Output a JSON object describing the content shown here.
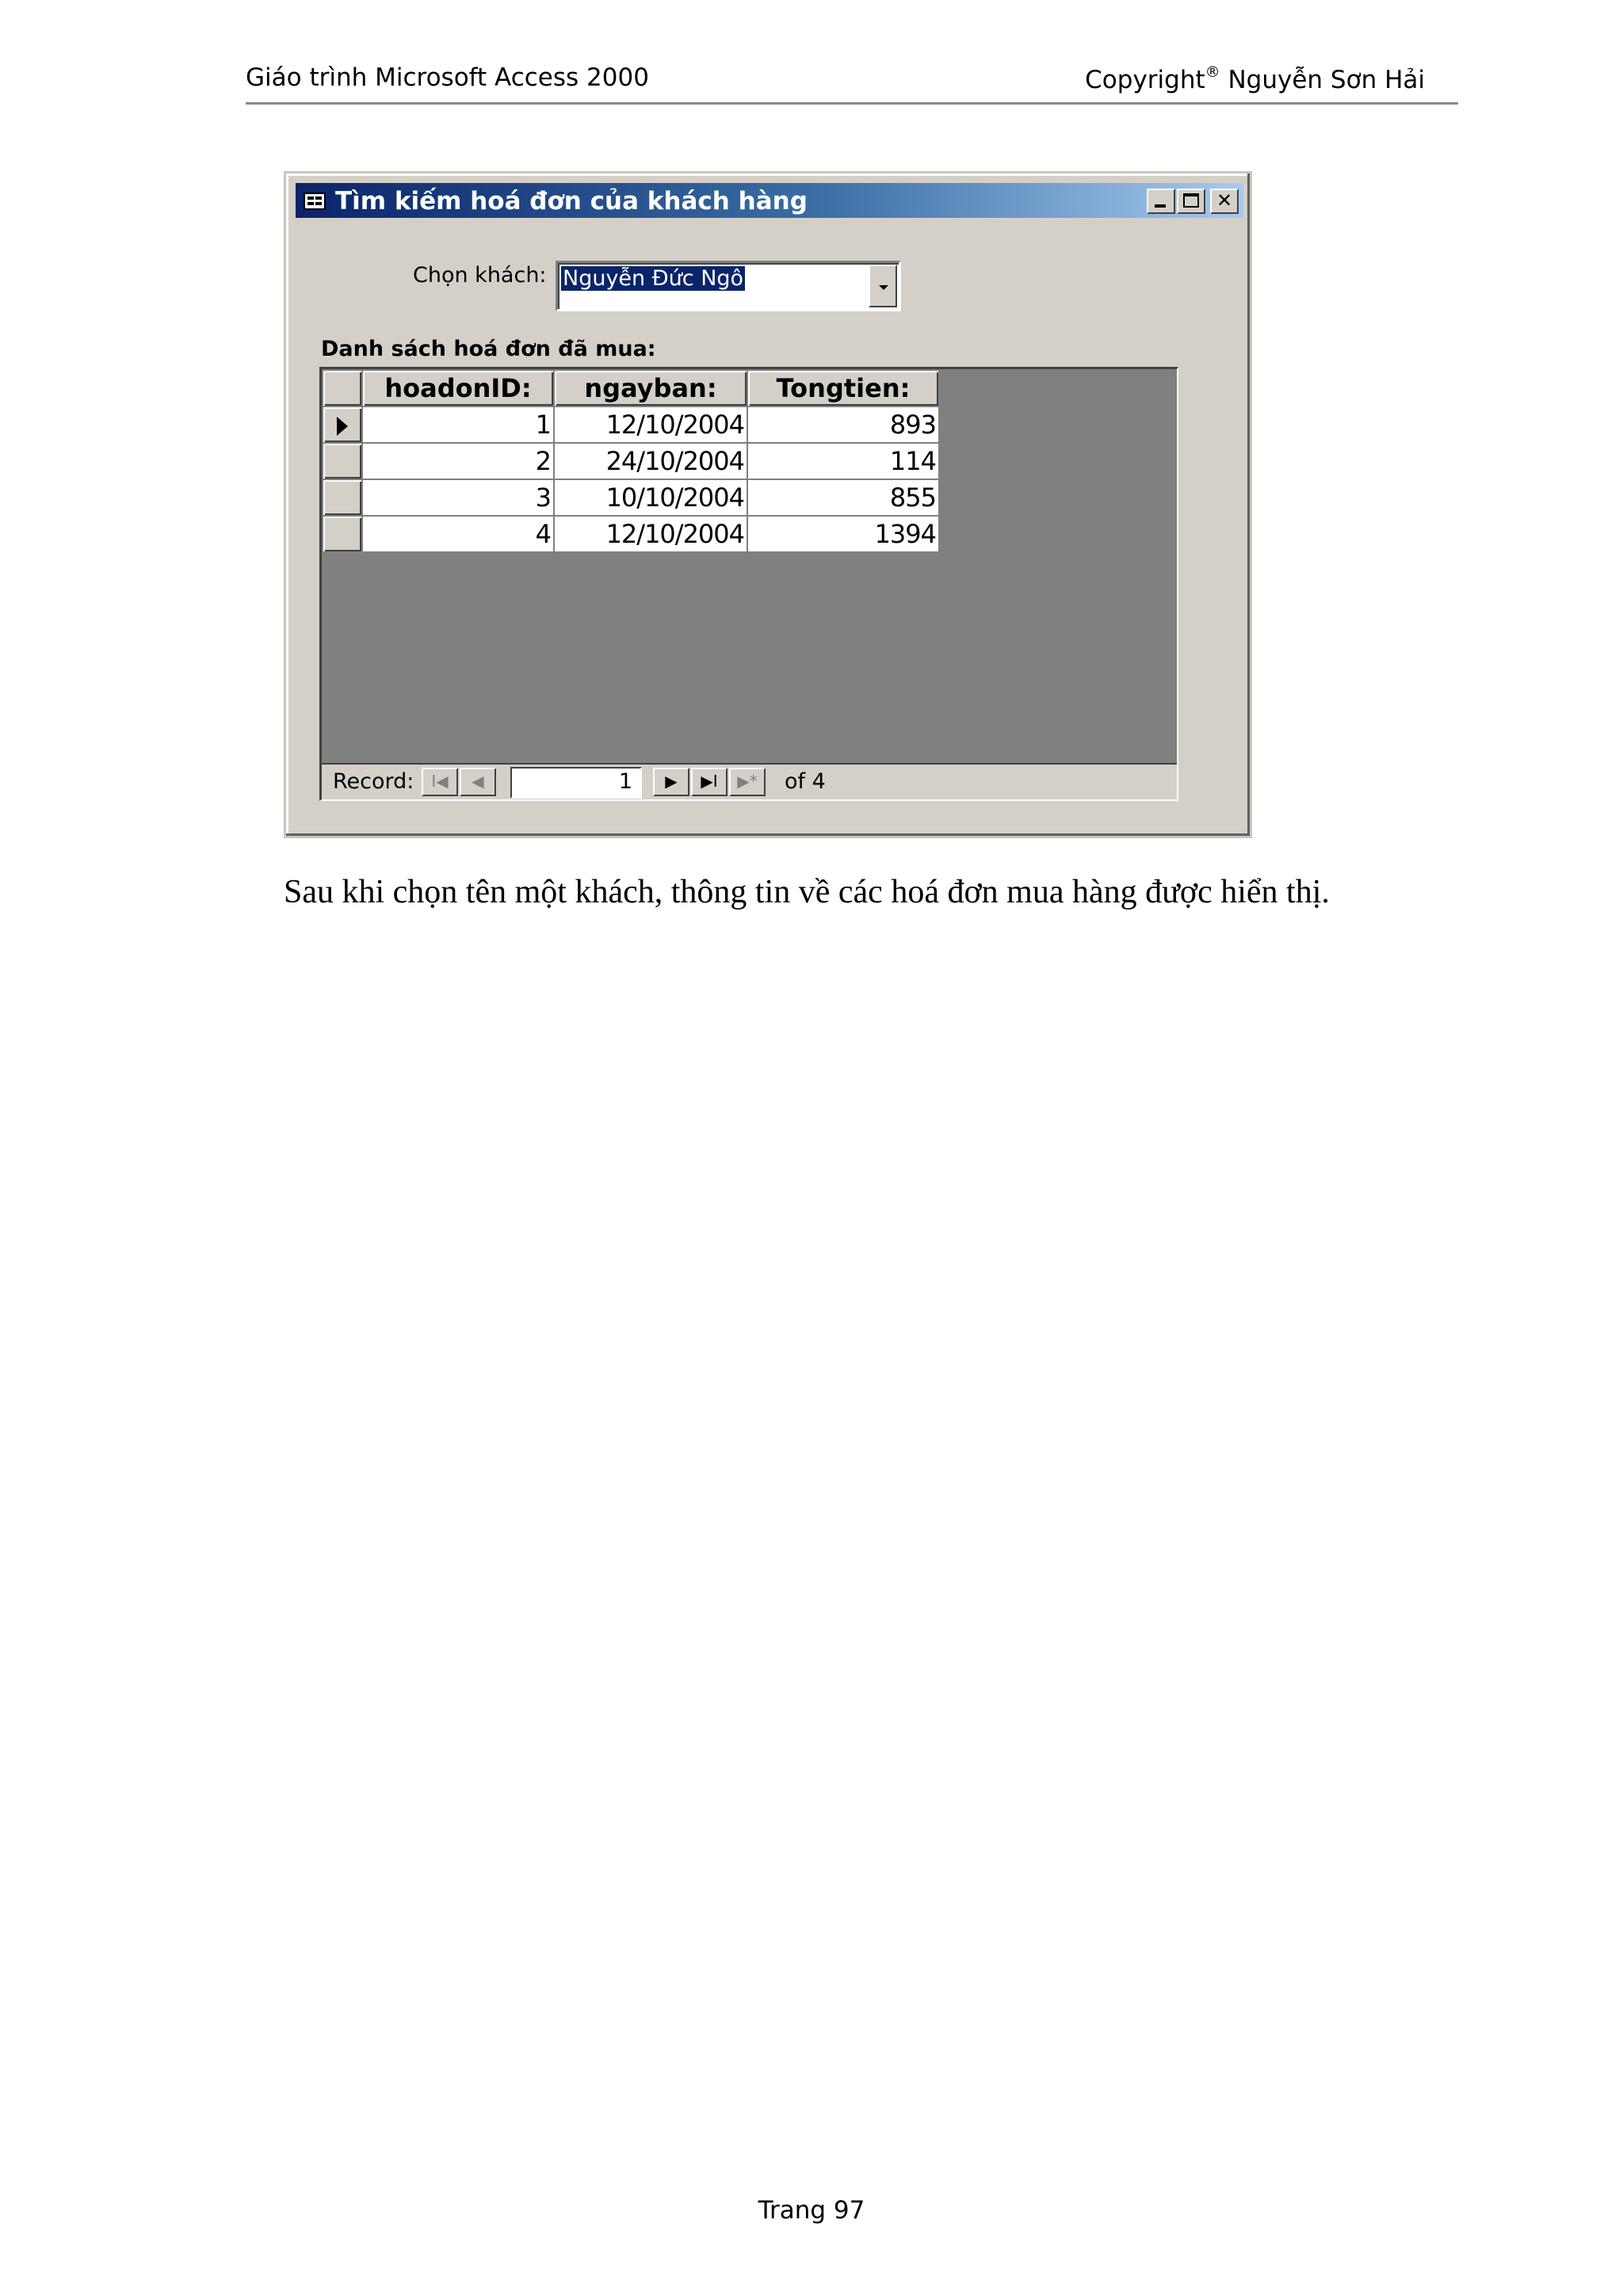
{
  "header": {
    "left": "Giáo trình Microsoft Access 2000",
    "right_prefix": "Copyright",
    "right_sup": "®",
    "right_suffix": " Nguyễn Sơn Hải"
  },
  "window": {
    "title": "Tìm kiếm hoá đơn của khách hàng",
    "controls": {
      "minimize": "_",
      "maximize": "□",
      "close": "✕"
    },
    "customer_label": "Chọn khách:",
    "customer_value": "Nguyễn Đức Ngô",
    "list_label": "Danh sách hoá đơn đã mua:",
    "grid": {
      "columns": [
        "hoadonID:",
        "ngayban:",
        "Tongtien:"
      ],
      "rows": [
        {
          "id": "1",
          "date": "12/10/2004",
          "total": "893"
        },
        {
          "id": "2",
          "date": "24/10/2004",
          "total": "114"
        },
        {
          "id": "3",
          "date": "10/10/2004",
          "total": "855"
        },
        {
          "id": "4",
          "date": "12/10/2004",
          "total": "1394"
        }
      ]
    },
    "navigator": {
      "label": "Record:",
      "current": "1",
      "of_text": "of  4",
      "first": "I◀",
      "prev": "◀",
      "next": "▶",
      "last": "▶I",
      "new": "▶*"
    }
  },
  "caption": "Sau khi chọn tên một khách, thông tin về các hoá đơn mua hàng được hiển thị.",
  "footer": "Trang 97"
}
